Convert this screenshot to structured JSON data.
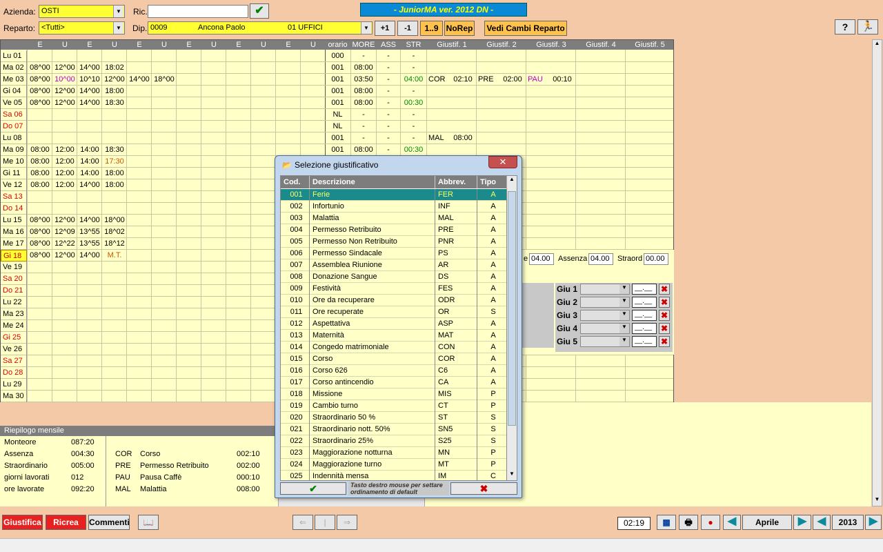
{
  "header": {
    "azienda_label": "Azienda:",
    "azienda_value": "OSTI",
    "reparto_label": "Reparto:",
    "reparto_value": "<Tutti>",
    "ric_label": "Ric.",
    "ric_value": "",
    "dip_label": "Dip.",
    "dip_code": "0009",
    "dip_name": "Ancona  Paolo",
    "dip_dept": "01 UFFICI",
    "app_title": "-  JuniorMA  ver. 2012 DN  -",
    "btn_plus1": "+1",
    "btn_minus1": "-1",
    "btn_range": "1..9",
    "btn_norep": "NoRep",
    "btn_vedi": "Vedi Cambi Reparto",
    "help_icon": "?"
  },
  "left_grid": {
    "headers": [
      "E",
      "U",
      "E",
      "U",
      "E",
      "U",
      "E",
      "U",
      "E",
      "U",
      "E",
      "U"
    ],
    "rows": [
      {
        "day": "Lu 01",
        "red": false,
        "t": [
          "",
          "",
          "",
          "",
          "",
          ""
        ]
      },
      {
        "day": "Ma 02",
        "red": false,
        "t": [
          "08^00",
          "12^00",
          "14^00",
          "18:02",
          "",
          ""
        ]
      },
      {
        "day": "Me 03",
        "red": false,
        "t": [
          "08^00",
          "10^00",
          "10^10",
          "12^00",
          "14^00",
          "18^00"
        ],
        "mag": [
          1
        ]
      },
      {
        "day": "Gi  04",
        "red": false,
        "t": [
          "08^00",
          "12^00",
          "14^00",
          "18:00",
          "",
          ""
        ]
      },
      {
        "day": "Ve 05",
        "red": false,
        "t": [
          "08^00",
          "12^00",
          "14^00",
          "18:30",
          "",
          ""
        ]
      },
      {
        "day": "Sa 06",
        "red": true,
        "t": [
          "",
          "",
          "",
          "",
          "",
          ""
        ]
      },
      {
        "day": "Do 07",
        "red": true,
        "t": [
          "",
          "",
          "",
          "",
          "",
          ""
        ]
      },
      {
        "day": "Lu 08",
        "red": false,
        "t": [
          "",
          "",
          "",
          "",
          "",
          ""
        ]
      },
      {
        "day": "Ma 09",
        "red": false,
        "t": [
          "08:00",
          "12:00",
          "14:00",
          "18:30",
          "",
          ""
        ]
      },
      {
        "day": "Me 10",
        "red": false,
        "t": [
          "08:00",
          "12:00",
          "14:00",
          "17:30",
          "",
          ""
        ],
        "org": [
          3
        ]
      },
      {
        "day": "Gi  11",
        "red": false,
        "t": [
          "08:00",
          "12:00",
          "14:00",
          "18:00",
          "",
          ""
        ]
      },
      {
        "day": "Ve 12",
        "red": false,
        "t": [
          "08:00",
          "12:00",
          "14^00",
          "18:00",
          "",
          ""
        ]
      },
      {
        "day": "Sa 13",
        "red": true,
        "t": [
          "",
          "",
          "",
          "",
          "",
          ""
        ]
      },
      {
        "day": "Do 14",
        "red": true,
        "t": [
          "",
          "",
          "",
          "",
          "",
          ""
        ]
      },
      {
        "day": "Lu 15",
        "red": false,
        "t": [
          "08^00",
          "12^00",
          "14^00",
          "18^00",
          "",
          ""
        ]
      },
      {
        "day": "Ma 16",
        "red": false,
        "t": [
          "08^00",
          "12^09",
          "13^55",
          "18^02",
          "",
          ""
        ]
      },
      {
        "day": "Me 17",
        "red": false,
        "t": [
          "08^00",
          "12^22",
          "13^55",
          "18^12",
          "",
          ""
        ]
      },
      {
        "day": "Gi  18",
        "red": false,
        "t": [
          "08^00",
          "12^00",
          "14^00",
          "M.T.",
          "",
          ""
        ],
        "org": [
          3
        ],
        "today": true
      },
      {
        "day": "Ve 19",
        "red": false,
        "t": [
          "",
          "",
          "",
          "",
          "",
          ""
        ]
      },
      {
        "day": "Sa 20",
        "red": true,
        "t": [
          "",
          "",
          "",
          "",
          "",
          ""
        ]
      },
      {
        "day": "Do 21",
        "red": true,
        "t": [
          "",
          "",
          "",
          "",
          "",
          ""
        ]
      },
      {
        "day": "Lu 22",
        "red": false,
        "t": [
          "",
          "",
          "",
          "",
          "",
          ""
        ]
      },
      {
        "day": "Ma 23",
        "red": false,
        "t": [
          "",
          "",
          "",
          "",
          "",
          ""
        ]
      },
      {
        "day": "Me 24",
        "red": false,
        "t": [
          "",
          "",
          "",
          "",
          "",
          ""
        ]
      },
      {
        "day": "Gi  25",
        "red": true,
        "t": [
          "",
          "",
          "",
          "",
          "",
          ""
        ]
      },
      {
        "day": "Ve 26",
        "red": false,
        "t": [
          "",
          "",
          "",
          "",
          "",
          ""
        ]
      },
      {
        "day": "Sa 27",
        "red": true,
        "t": [
          "",
          "",
          "",
          "",
          "",
          ""
        ]
      },
      {
        "day": "Do 28",
        "red": true,
        "t": [
          "",
          "",
          "",
          "",
          "",
          ""
        ]
      },
      {
        "day": "Lu 29",
        "red": false,
        "t": [
          "",
          "",
          "",
          "",
          "",
          ""
        ]
      },
      {
        "day": "Ma 30",
        "red": false,
        "t": [
          "",
          "",
          "",
          "",
          "",
          ""
        ]
      }
    ]
  },
  "right_grid": {
    "headers": [
      "orario",
      "MORE",
      "ASS",
      "STR",
      "Giustif. 1",
      "Giustif. 2",
      "Giustif. 3",
      "Giustif. 4",
      "Giustif. 5"
    ],
    "rows": [
      {
        "o": "000",
        "m": "-",
        "a": "-",
        "s": "-",
        "g": []
      },
      {
        "o": "001",
        "m": "08:00",
        "a": "-",
        "s": "-",
        "g": []
      },
      {
        "o": "001",
        "m": "03:50",
        "a": "-",
        "s": "04:00",
        "g": [
          [
            "COR",
            "02:10"
          ],
          [
            "PRE",
            "02:00"
          ],
          [
            "PAU",
            "00:10"
          ]
        ],
        "sg": true
      },
      {
        "o": "001",
        "m": "08:00",
        "a": "-",
        "s": "-",
        "g": []
      },
      {
        "o": "001",
        "m": "08:00",
        "a": "-",
        "s": "00:30",
        "g": [],
        "sg": true
      },
      {
        "o": "NL",
        "m": "-",
        "a": "-",
        "s": "-",
        "g": []
      },
      {
        "o": "NL",
        "m": "-",
        "a": "-",
        "s": "-",
        "g": []
      },
      {
        "o": "001",
        "m": "-",
        "a": "-",
        "s": "-",
        "g": [
          [
            "MAL",
            "08:00"
          ]
        ]
      },
      {
        "o": "001",
        "m": "08:00",
        "a": "-",
        "s": "00:30",
        "g": [],
        "sg": true
      }
    ]
  },
  "summary": {
    "title": "Riepilogo mensile",
    "left": [
      [
        "Monteore",
        "087:20"
      ],
      [
        "Assenza",
        "004:30"
      ],
      [
        "Straordinario",
        "005:00"
      ],
      [
        "giorni lavorati",
        "012"
      ],
      [
        "ore lavorate",
        "092:20"
      ]
    ],
    "right": [
      [
        "COR",
        "Corso",
        "002:10"
      ],
      [
        "PRE",
        "Permesso Retribuito",
        "002:00"
      ],
      [
        "PAU",
        "Pausa Caffè",
        "000:10"
      ],
      [
        "MAL",
        "Malattia",
        "008:00"
      ]
    ]
  },
  "side": {
    "e_value": "04.00",
    "assenza_label": "Assenza",
    "assenza_value": "04.00",
    "straord_label": "Straord",
    "straord_value": "00.00",
    "giu": [
      "Giu 1",
      "Giu 2",
      "Giu 3",
      "Giu 4",
      "Giu 5"
    ],
    "giu_time": "__.__"
  },
  "dialog": {
    "title": "Selezione giustificativo",
    "cols": [
      "Cod.",
      "Descrizione",
      "Abbrev.",
      "Tipo"
    ],
    "hint": "Tasto destro mouse per settare ordinamento di default",
    "rows": [
      [
        "001",
        "Ferie",
        "FER",
        "A"
      ],
      [
        "002",
        "Infortunio",
        "INF",
        "A"
      ],
      [
        "003",
        "Malattia",
        "MAL",
        "A"
      ],
      [
        "004",
        "Permesso Retribuito",
        "PRE",
        "A"
      ],
      [
        "005",
        "Permesso Non Retribuito",
        "PNR",
        "A"
      ],
      [
        "006",
        "Permesso Sindacale",
        "PS",
        "A"
      ],
      [
        "007",
        "Assemblea Riunione",
        "AR",
        "A"
      ],
      [
        "008",
        "Donazione Sangue",
        "DS",
        "A"
      ],
      [
        "009",
        "Festività",
        "FES",
        "A"
      ],
      [
        "010",
        "Ore da recuperare",
        "ODR",
        "A"
      ],
      [
        "011",
        "Ore recuperate",
        "OR",
        "S"
      ],
      [
        "012",
        "Aspettativa",
        "ASP",
        "A"
      ],
      [
        "013",
        "Maternità",
        "MAT",
        "A"
      ],
      [
        "014",
        "Congedo matrimoniale",
        "CON",
        "A"
      ],
      [
        "015",
        "Corso",
        "COR",
        "A"
      ],
      [
        "016",
        "Corso 626",
        "C6",
        "A"
      ],
      [
        "017",
        "Corso antincendio",
        "CA",
        "A"
      ],
      [
        "018",
        "Missione",
        "MIS",
        "P"
      ],
      [
        "019",
        "Cambio turno",
        "CT",
        "P"
      ],
      [
        "020",
        "Straordinario 50 %",
        "ST",
        "S"
      ],
      [
        "021",
        "Straordinario nott. 50%",
        "SN5",
        "S"
      ],
      [
        "022",
        "Straordinario 25%",
        "S25",
        "S"
      ],
      [
        "023",
        "Maggiorazione notturna",
        "MN",
        "P"
      ],
      [
        "024",
        "Maggiorazione turno",
        "MT",
        "P"
      ],
      [
        "025",
        "Indennità mensa",
        "IM",
        "C"
      ]
    ]
  },
  "footer": {
    "giustifica": "Giustifica",
    "ricrea": "Ricrea",
    "commenti": "Commenti",
    "time": "02:19",
    "month": "Aprile",
    "year": "2013"
  }
}
